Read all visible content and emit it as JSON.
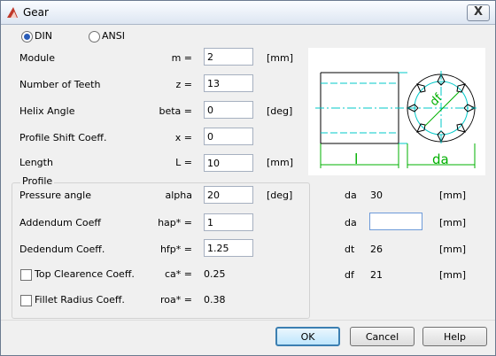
{
  "window": {
    "title": "Gear",
    "close_label": "X"
  },
  "standard": {
    "options": [
      "DIN",
      "ANSI"
    ],
    "selected": "DIN"
  },
  "params": [
    {
      "label": "Module",
      "symbol": "m =",
      "value": "2",
      "unit": "[mm]"
    },
    {
      "label": "Number of Teeth",
      "symbol": "z =",
      "value": "13",
      "unit": ""
    },
    {
      "label": "Helix Angle",
      "symbol": "beta =",
      "value": "0",
      "unit": "[deg]"
    },
    {
      "label": "Profile Shift Coeff.",
      "symbol": "x =",
      "value": "0",
      "unit": ""
    },
    {
      "label": "Length",
      "symbol": "L =",
      "value": "10",
      "unit": "[mm]"
    }
  ],
  "profile": {
    "title": "Profile",
    "pressure_angle": {
      "label": "Pressure angle",
      "symbol": "alpha",
      "value": "20",
      "unit": "[deg]"
    },
    "addendum": {
      "label": "Addendum Coeff",
      "symbol": "hap* =",
      "value": "1"
    },
    "dedendum": {
      "label": "Dedendum Coeff.",
      "symbol": "hfp* =",
      "value": "1.25"
    },
    "top_clearance": {
      "label": "Top Clearence Coeff.",
      "symbol": "ca* =",
      "value": "0.25",
      "checked": false
    },
    "fillet_radius": {
      "label": "Fillet Radius Coeff.",
      "symbol": "roa* =",
      "value": "0.38",
      "checked": false
    }
  },
  "results": [
    {
      "symbol": "da",
      "value": "30",
      "unit": "[mm]",
      "editable": false
    },
    {
      "symbol": "da",
      "value": "",
      "unit": "[mm]",
      "editable": true
    },
    {
      "symbol": "dt",
      "value": "26",
      "unit": "[mm]",
      "editable": false
    },
    {
      "symbol": "df",
      "value": "21",
      "unit": "[mm]",
      "editable": false
    }
  ],
  "preview": {
    "length_label": "l",
    "diameter_label": "da",
    "root_label": "df"
  },
  "buttons": {
    "ok": "OK",
    "cancel": "Cancel",
    "help": "Help"
  },
  "colors": {
    "accent": "#00c8c8",
    "green": "#00b000",
    "title_icon": "#c0392b"
  }
}
